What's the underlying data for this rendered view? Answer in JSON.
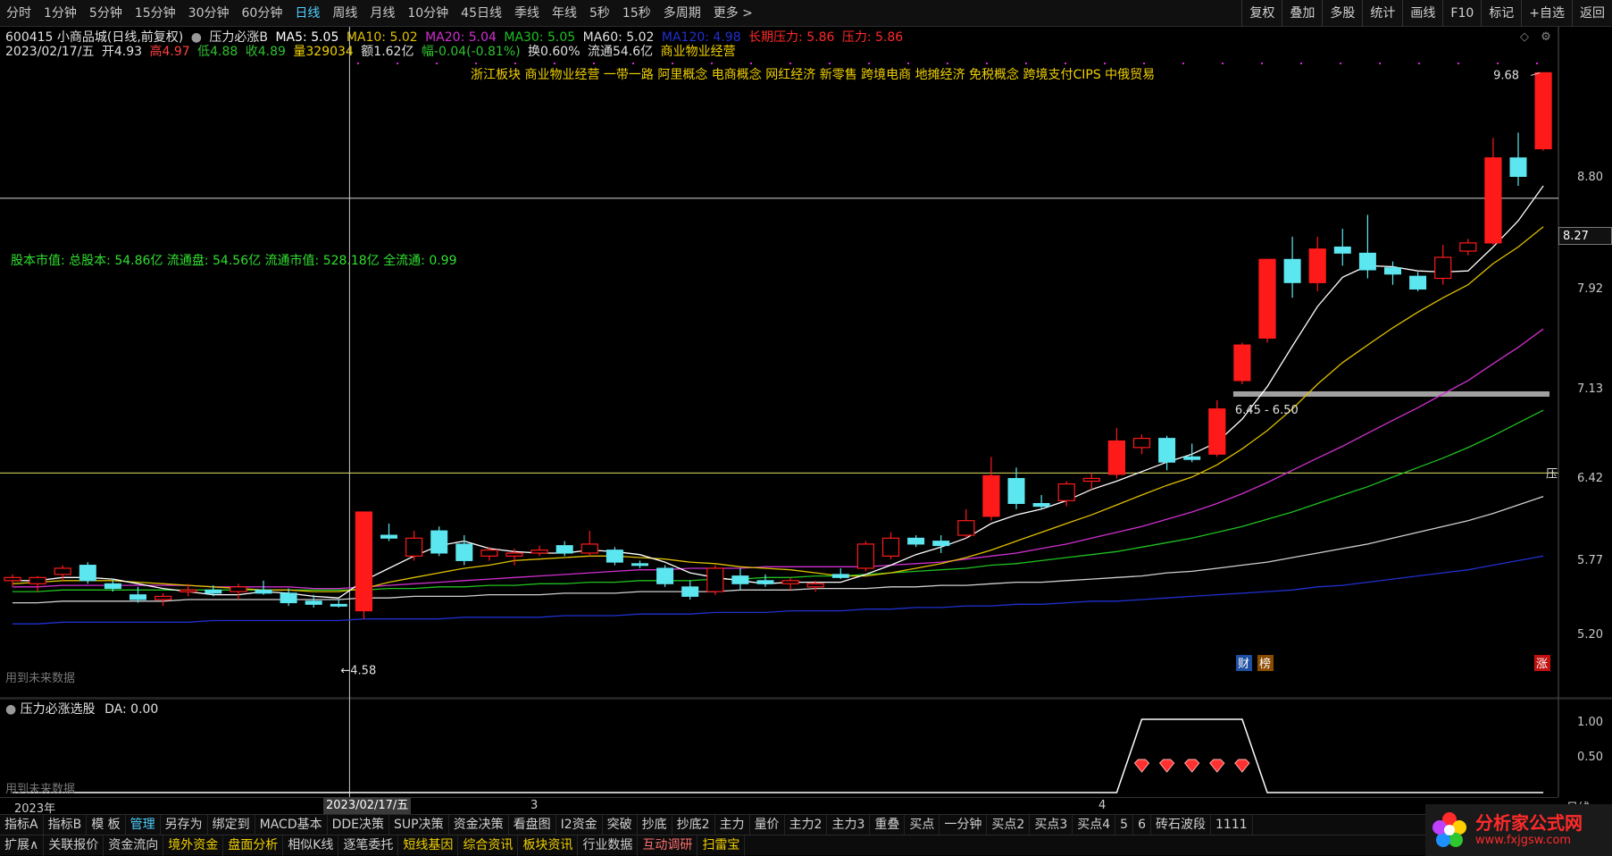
{
  "top_bar": {
    "periods": [
      "分时",
      "1分钟",
      "5分钟",
      "15分钟",
      "30分钟",
      "60分钟",
      "日线",
      "周线",
      "月线",
      "10分钟",
      "45日线",
      "季线",
      "年线",
      "5秒",
      "15秒",
      "多周期",
      "更多 >"
    ],
    "active_period": "日线",
    "tools": [
      "复权",
      "叠加",
      "多股",
      "统计",
      "画线",
      "F10",
      "标记",
      "+自选",
      "返回"
    ]
  },
  "info": {
    "stock": "600415 小商品城(日线,前复权)",
    "indicator": "压力必涨B",
    "ma5": "MA5: 5.05",
    "ma10": "MA10: 5.02",
    "ma20": "MA20: 5.04",
    "ma30": "MA30: 5.05",
    "ma60": "MA60: 5.02",
    "ma120": "MA120: 4.98",
    "long_pressure": "长期压力: 5.86",
    "pressure": "压力: 5.86",
    "date": "2023/02/17/五",
    "open": "开4.93",
    "high": "高4.97",
    "low": "低4.88",
    "close": "收4.89",
    "volume": "量329034",
    "amount": "额1.62亿",
    "change": "幅-0.04(-0.81%)",
    "turnover": "换0.60%",
    "float": "流通54.6亿",
    "business": "商业物业经营"
  },
  "concepts": "浙江板块 商业物业经营 一带一路 阿里概念 电商概念 网红经济 新零售 跨境电商 地摊经济 免税概念 跨境支付CIPS 中俄贸易",
  "cap_info": "股本市值: 总股本: 54.86亿 流通盘: 54.56亿 流通市值: 528.18亿 全流通: 0.99",
  "price_axis": [
    "8.80",
    "7.92",
    "7.13",
    "6.42",
    "5.77",
    "5.20"
  ],
  "current_price": "8.27",
  "annotations": {
    "high": "9.68",
    "low": "4.58",
    "range": "6.45 - 6.50",
    "pressure_tag": "压",
    "future_note": "用到未来数据",
    "badge_cai": "财",
    "badge_bang": "榜",
    "badge_zhang": "涨"
  },
  "sub_chart": {
    "title": "压力必涨选股",
    "da": "DA: 0.00",
    "axis": [
      "1.00",
      "0.50"
    ],
    "future_note": "用到未来数据"
  },
  "date_axis": {
    "year": "2023年",
    "cursor": "2023/02/17/五",
    "m3": "3",
    "m4": "4",
    "right": "日线"
  },
  "bottom_tabs_1": [
    "指标A",
    "指标B",
    "模 板",
    "管理",
    "另存为",
    "绑定到",
    "MACD基本",
    "DDE决策",
    "SUP决策",
    "资金决策",
    "看盘图",
    "I2资金",
    "突破",
    "抄底",
    "抄底2",
    "主力",
    "量价",
    "主力2",
    "主力3",
    "重叠",
    "买点",
    "一分钟",
    "买点2",
    "买点3",
    "买点4",
    "5",
    "6",
    "砖石波段",
    "1111"
  ],
  "bottom_tabs_2": [
    "扩展∧",
    "关联报价",
    "资金流向",
    "境外资金",
    "盘面分析",
    "相似K线",
    "逐笔委托",
    "短线基因",
    "综合资讯",
    "板块资讯",
    "行业数据",
    "互动调研",
    "扫雷宝"
  ],
  "watermark": {
    "title": "分析家公式网",
    "url": "www.fxjgsw.com"
  },
  "colors": {
    "up": "#ff1a1a",
    "down": "#5ce6f0",
    "ma5": "#ffffff",
    "ma10": "#e0c000",
    "ma20": "#d030d0",
    "ma30": "#20c020",
    "ma60": "#d0d0d0",
    "ma120": "#2030d0"
  },
  "chart_data": {
    "type": "candlestick",
    "price_range": [
      5.0,
      9.75
    ],
    "candles": [
      {
        "o": 5.12,
        "h": 5.16,
        "l": 5.08,
        "c": 5.14
      },
      {
        "o": 5.1,
        "h": 5.15,
        "l": 5.05,
        "c": 5.14
      },
      {
        "o": 5.16,
        "h": 5.22,
        "l": 5.12,
        "c": 5.2
      },
      {
        "o": 5.22,
        "h": 5.24,
        "l": 5.1,
        "c": 5.12
      },
      {
        "o": 5.1,
        "h": 5.13,
        "l": 5.05,
        "c": 5.07
      },
      {
        "o": 5.03,
        "h": 5.08,
        "l": 4.98,
        "c": 5.0
      },
      {
        "o": 5.0,
        "h": 5.04,
        "l": 4.96,
        "c": 5.02
      },
      {
        "o": 5.05,
        "h": 5.1,
        "l": 5.02,
        "c": 5.06
      },
      {
        "o": 5.06,
        "h": 5.09,
        "l": 5.02,
        "c": 5.04
      },
      {
        "o": 5.05,
        "h": 5.1,
        "l": 5.0,
        "c": 5.08
      },
      {
        "o": 5.06,
        "h": 5.12,
        "l": 5.03,
        "c": 5.04
      },
      {
        "o": 5.04,
        "h": 5.07,
        "l": 4.96,
        "c": 4.98
      },
      {
        "o": 4.99,
        "h": 5.03,
        "l": 4.95,
        "c": 4.97
      },
      {
        "o": 4.97,
        "h": 5.0,
        "l": 4.95,
        "c": 4.96
      },
      {
        "o": 4.93,
        "h": 5.58,
        "l": 4.88,
        "c": 5.58
      },
      {
        "o": 5.42,
        "h": 5.5,
        "l": 5.38,
        "c": 5.4
      },
      {
        "o": 5.28,
        "h": 5.45,
        "l": 5.25,
        "c": 5.4
      },
      {
        "o": 5.45,
        "h": 5.48,
        "l": 5.28,
        "c": 5.3
      },
      {
        "o": 5.36,
        "h": 5.42,
        "l": 5.22,
        "c": 5.25
      },
      {
        "o": 5.28,
        "h": 5.34,
        "l": 5.25,
        "c": 5.32
      },
      {
        "o": 5.28,
        "h": 5.33,
        "l": 5.22,
        "c": 5.3
      },
      {
        "o": 5.3,
        "h": 5.35,
        "l": 5.28,
        "c": 5.32
      },
      {
        "o": 5.35,
        "h": 5.38,
        "l": 5.28,
        "c": 5.3
      },
      {
        "o": 5.3,
        "h": 5.45,
        "l": 5.28,
        "c": 5.36
      },
      {
        "o": 5.32,
        "h": 5.34,
        "l": 5.22,
        "c": 5.24
      },
      {
        "o": 5.23,
        "h": 5.25,
        "l": 5.2,
        "c": 5.22
      },
      {
        "o": 5.2,
        "h": 5.22,
        "l": 5.08,
        "c": 5.1
      },
      {
        "o": 5.08,
        "h": 5.12,
        "l": 5.0,
        "c": 5.02
      },
      {
        "o": 5.05,
        "h": 5.22,
        "l": 5.03,
        "c": 5.2
      },
      {
        "o": 5.15,
        "h": 5.2,
        "l": 5.06,
        "c": 5.1
      },
      {
        "o": 5.12,
        "h": 5.16,
        "l": 5.08,
        "c": 5.1
      },
      {
        "o": 5.1,
        "h": 5.14,
        "l": 5.06,
        "c": 5.12
      },
      {
        "o": 5.08,
        "h": 5.12,
        "l": 5.05,
        "c": 5.1
      },
      {
        "o": 5.16,
        "h": 5.2,
        "l": 5.13,
        "c": 5.14
      },
      {
        "o": 5.2,
        "h": 5.38,
        "l": 5.18,
        "c": 5.36
      },
      {
        "o": 5.28,
        "h": 5.44,
        "l": 5.26,
        "c": 5.4
      },
      {
        "o": 5.4,
        "h": 5.42,
        "l": 5.34,
        "c": 5.36
      },
      {
        "o": 5.38,
        "h": 5.42,
        "l": 5.3,
        "c": 5.35
      },
      {
        "o": 5.42,
        "h": 5.6,
        "l": 5.4,
        "c": 5.52
      },
      {
        "o": 5.55,
        "h": 5.98,
        "l": 5.52,
        "c": 5.84
      },
      {
        "o": 5.82,
        "h": 5.9,
        "l": 5.6,
        "c": 5.64
      },
      {
        "o": 5.64,
        "h": 5.7,
        "l": 5.6,
        "c": 5.62
      },
      {
        "o": 5.66,
        "h": 5.8,
        "l": 5.62,
        "c": 5.78
      },
      {
        "o": 5.8,
        "h": 5.86,
        "l": 5.74,
        "c": 5.82
      },
      {
        "o": 5.85,
        "h": 6.2,
        "l": 5.82,
        "c": 6.1
      },
      {
        "o": 6.05,
        "h": 6.15,
        "l": 6.0,
        "c": 6.12
      },
      {
        "o": 6.12,
        "h": 6.14,
        "l": 5.88,
        "c": 5.94
      },
      {
        "o": 5.98,
        "h": 6.08,
        "l": 5.94,
        "c": 5.96
      },
      {
        "o": 6.0,
        "h": 6.42,
        "l": 5.98,
        "c": 6.35
      },
      {
        "o": 6.58,
        "h": 6.9,
        "l": 6.55,
        "c": 6.88
      },
      {
        "o": 6.94,
        "h": 7.66,
        "l": 6.9,
        "c": 7.66
      },
      {
        "o": 7.66,
        "h": 7.88,
        "l": 7.3,
        "c": 7.44
      },
      {
        "o": 7.44,
        "h": 7.88,
        "l": 7.36,
        "c": 7.76
      },
      {
        "o": 7.78,
        "h": 7.96,
        "l": 7.6,
        "c": 7.72
      },
      {
        "o": 7.72,
        "h": 8.1,
        "l": 7.48,
        "c": 7.56
      },
      {
        "o": 7.58,
        "h": 7.64,
        "l": 7.42,
        "c": 7.52
      },
      {
        "o": 7.5,
        "h": 7.54,
        "l": 7.36,
        "c": 7.38
      },
      {
        "o": 7.48,
        "h": 7.8,
        "l": 7.42,
        "c": 7.68
      },
      {
        "o": 7.74,
        "h": 7.86,
        "l": 7.7,
        "c": 7.82
      },
      {
        "o": 7.82,
        "h": 8.92,
        "l": 7.8,
        "c": 8.7
      },
      {
        "o": 8.7,
        "h": 8.98,
        "l": 8.4,
        "c": 8.5
      },
      {
        "o": 8.8,
        "h": 9.68,
        "l": 8.78,
        "c": 9.68
      }
    ],
    "ma5": [
      5.12,
      5.12,
      5.14,
      5.14,
      5.13,
      5.1,
      5.07,
      5.05,
      5.03,
      5.03,
      5.05,
      5.04,
      5.02,
      5.01,
      5.12,
      5.2,
      5.28,
      5.35,
      5.38,
      5.33,
      5.31,
      5.3,
      5.3,
      5.32,
      5.31,
      5.29,
      5.24,
      5.17,
      5.14,
      5.12,
      5.1,
      5.11,
      5.11,
      5.11,
      5.16,
      5.22,
      5.29,
      5.34,
      5.4,
      5.5,
      5.56,
      5.6,
      5.66,
      5.74,
      5.8,
      5.87,
      5.94,
      6.0,
      6.09,
      6.27,
      6.53,
      6.87,
      7.22,
      7.49,
      7.6,
      7.59,
      7.55,
      7.54,
      7.55,
      7.78,
      8.04,
      8.4
    ],
    "ma10": [
      5.1,
      5.11,
      5.12,
      5.12,
      5.12,
      5.11,
      5.1,
      5.09,
      5.08,
      5.07,
      5.06,
      5.06,
      5.05,
      5.05,
      5.07,
      5.11,
      5.14,
      5.17,
      5.2,
      5.22,
      5.25,
      5.26,
      5.27,
      5.28,
      5.28,
      5.27,
      5.26,
      5.24,
      5.23,
      5.21,
      5.2,
      5.19,
      5.17,
      5.15,
      5.15,
      5.17,
      5.2,
      5.23,
      5.27,
      5.32,
      5.38,
      5.44,
      5.5,
      5.56,
      5.63,
      5.7,
      5.77,
      5.83,
      5.92,
      6.04,
      6.18,
      6.35,
      6.55,
      6.73,
      6.88,
      7.03,
      7.17,
      7.3,
      7.42,
      7.62,
      7.78,
      7.98
    ],
    "ma20": [
      5.08,
      5.08,
      5.09,
      5.09,
      5.09,
      5.09,
      5.09,
      5.09,
      5.08,
      5.08,
      5.08,
      5.08,
      5.07,
      5.07,
      5.08,
      5.09,
      5.1,
      5.11,
      5.12,
      5.13,
      5.14,
      5.15,
      5.16,
      5.17,
      5.18,
      5.19,
      5.19,
      5.2,
      5.2,
      5.2,
      5.21,
      5.21,
      5.21,
      5.21,
      5.21,
      5.22,
      5.23,
      5.24,
      5.26,
      5.28,
      5.3,
      5.33,
      5.36,
      5.4,
      5.44,
      5.48,
      5.53,
      5.58,
      5.64,
      5.71,
      5.79,
      5.88,
      5.97,
      6.06,
      6.16,
      6.26,
      6.36,
      6.47,
      6.58,
      6.72,
      6.86,
      7.02
    ],
    "ma30": [
      5.05,
      5.05,
      5.06,
      5.06,
      5.06,
      5.06,
      5.06,
      5.06,
      5.06,
      5.06,
      5.06,
      5.06,
      5.06,
      5.06,
      5.06,
      5.07,
      5.07,
      5.08,
      5.08,
      5.09,
      5.09,
      5.1,
      5.1,
      5.11,
      5.11,
      5.12,
      5.12,
      5.12,
      5.13,
      5.13,
      5.14,
      5.14,
      5.15,
      5.15,
      5.16,
      5.17,
      5.18,
      5.19,
      5.2,
      5.22,
      5.23,
      5.25,
      5.27,
      5.29,
      5.31,
      5.34,
      5.37,
      5.4,
      5.44,
      5.48,
      5.53,
      5.58,
      5.64,
      5.7,
      5.76,
      5.83,
      5.9,
      5.97,
      6.05,
      6.14,
      6.24,
      6.34
    ],
    "ma60": [
      4.98,
      4.98,
      4.99,
      4.99,
      4.99,
      4.99,
      4.99,
      5.0,
      5.0,
      5.0,
      5.0,
      5.0,
      5.0,
      5.0,
      5.01,
      5.01,
      5.02,
      5.02,
      5.02,
      5.03,
      5.03,
      5.03,
      5.04,
      5.04,
      5.04,
      5.05,
      5.05,
      5.05,
      5.05,
      5.06,
      5.06,
      5.06,
      5.07,
      5.07,
      5.07,
      5.08,
      5.08,
      5.09,
      5.09,
      5.1,
      5.11,
      5.11,
      5.12,
      5.13,
      5.14,
      5.15,
      5.17,
      5.18,
      5.2,
      5.22,
      5.24,
      5.27,
      5.3,
      5.33,
      5.36,
      5.4,
      5.44,
      5.48,
      5.52,
      5.57,
      5.63,
      5.69
    ],
    "ma120": [
      4.85,
      4.85,
      4.86,
      4.86,
      4.86,
      4.86,
      4.86,
      4.86,
      4.87,
      4.87,
      4.87,
      4.87,
      4.87,
      4.87,
      4.88,
      4.88,
      4.88,
      4.88,
      4.89,
      4.89,
      4.89,
      4.89,
      4.9,
      4.9,
      4.9,
      4.91,
      4.91,
      4.91,
      4.92,
      4.92,
      4.92,
      4.93,
      4.93,
      4.93,
      4.94,
      4.94,
      4.95,
      4.95,
      4.96,
      4.96,
      4.97,
      4.97,
      4.98,
      4.99,
      4.99,
      5.0,
      5.01,
      5.02,
      5.03,
      5.04,
      5.05,
      5.06,
      5.08,
      5.09,
      5.11,
      5.13,
      5.15,
      5.17,
      5.19,
      5.22,
      5.25,
      5.28
    ],
    "pressure_level": 5.86,
    "range_level": 6.47,
    "current_level": 8.27,
    "signal": [
      0,
      0,
      0,
      0,
      0,
      0,
      0,
      0,
      0,
      0,
      0,
      0,
      0,
      0,
      0,
      0,
      0,
      0,
      0,
      0,
      0,
      0,
      0,
      0,
      0,
      0,
      0,
      0,
      0,
      0,
      0,
      0,
      0,
      0,
      0,
      0,
      0,
      0,
      0,
      0,
      0,
      0,
      0,
      0,
      0,
      1,
      1,
      1,
      1,
      1,
      0,
      0,
      0,
      0,
      0,
      0,
      0,
      0,
      0,
      0,
      0,
      0
    ],
    "cursor_index": 14
  }
}
